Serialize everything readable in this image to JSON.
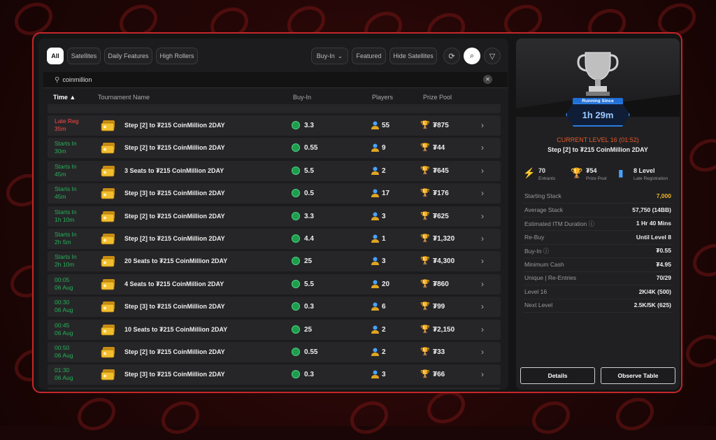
{
  "filters": {
    "all": "All",
    "satellites": "Satellites",
    "daily_features": "Daily Features",
    "high_rollers": "High Rollers",
    "buy_in": "Buy-In",
    "featured": "Featured",
    "hide_satellites": "Hide Satellites"
  },
  "search": {
    "value": "coinmillion"
  },
  "table": {
    "headers": {
      "time": "Time",
      "name": "Tournament Name",
      "buyin": "Buy-In",
      "players": "Players",
      "prize": "Prize Pool"
    },
    "rows": [
      {
        "time": "Late Reg\n35m",
        "status": "late",
        "name": "Step [2] to ₮215 CoinMillion 2DAY",
        "buyin": "3.3",
        "players": "55",
        "prize": "₮875"
      },
      {
        "time": "Starts In\n30m",
        "status": "starts",
        "name": "Step [2] to ₮215 CoinMillion 2DAY",
        "buyin": "0.55",
        "players": "9",
        "prize": "₮44"
      },
      {
        "time": "Starts In\n45m",
        "status": "starts",
        "name": "3 Seats to ₮215 CoinMillion 2DAY",
        "buyin": "5.5",
        "players": "2",
        "prize": "₮645"
      },
      {
        "time": "Starts In\n45m",
        "status": "starts",
        "name": "Step [3] to ₮215 CoinMillion 2DAY",
        "buyin": "0.5",
        "players": "17",
        "prize": "₮176"
      },
      {
        "time": "Starts In\n1h 10m",
        "status": "starts",
        "name": "Step [2] to ₮215 CoinMillion 2DAY",
        "buyin": "3.3",
        "players": "3",
        "prize": "₮625"
      },
      {
        "time": "Starts In\n2h 5m",
        "status": "starts",
        "name": "Step [2] to ₮215 CoinMillion 2DAY",
        "buyin": "4.4",
        "players": "1",
        "prize": "₮1,320"
      },
      {
        "time": "Starts In\n2h 10m",
        "status": "starts",
        "name": "20 Seats to ₮215 CoinMillion 2DAY",
        "buyin": "25",
        "players": "3",
        "prize": "₮4,300"
      },
      {
        "time": "00:05\n06 Aug",
        "status": "starts",
        "name": "4 Seats to ₮215 CoinMillion 2DAY",
        "buyin": "5.5",
        "players": "20",
        "prize": "₮860"
      },
      {
        "time": "00:30\n06 Aug",
        "status": "starts",
        "name": "Step [3] to ₮215 CoinMillion 2DAY",
        "buyin": "0.3",
        "players": "6",
        "prize": "₮99"
      },
      {
        "time": "00:45\n06 Aug",
        "status": "starts",
        "name": "10 Seats to ₮215 CoinMillion 2DAY",
        "buyin": "25",
        "players": "2",
        "prize": "₮2,150"
      },
      {
        "time": "00:50\n06 Aug",
        "status": "starts",
        "name": "Step [2] to ₮215 CoinMillion 2DAY",
        "buyin": "0.55",
        "players": "2",
        "prize": "₮33"
      },
      {
        "time": "01:30\n06 Aug",
        "status": "starts",
        "name": "Step [3] to ₮215 CoinMillion 2DAY",
        "buyin": "0.3",
        "players": "3",
        "prize": "₮66"
      }
    ]
  },
  "detail": {
    "running_label": "Running Since",
    "running_time": "1h 29m",
    "level": "CURRENT LEVEL 16 (01:52)",
    "name": "Step [2] to ₮215 CoinMillion 2DAY",
    "stats": {
      "entrants_value": "70",
      "entrants_label": "Entrants",
      "prize_value": "₮54",
      "prize_label": "Prize Pool",
      "latereg_value": "8 Level",
      "latereg_label": "Late Registration"
    },
    "rows": [
      {
        "k": "Starting Stack",
        "v": "7,000",
        "gold": true
      },
      {
        "k": "Average Stack",
        "v": "57,750 (14BB)"
      },
      {
        "k": "Estimated ITM Duration ⓘ",
        "v": "1 Hr 40 Mins"
      },
      {
        "k": "Re-Buy",
        "v": "Until Level 8"
      },
      {
        "k": "Buy-In ⓘ",
        "v": "₮0.55"
      },
      {
        "k": "Minimum Cash",
        "v": "₮4.95"
      },
      {
        "k": "Unique | Re-Entries",
        "v": "70/29"
      },
      {
        "k": "Level 16",
        "v": "2K/4K (500)"
      },
      {
        "k": "Next Level",
        "v": "2.5K/5K (625)"
      }
    ],
    "details_button": "Details",
    "observe_button": "Observe Table"
  }
}
